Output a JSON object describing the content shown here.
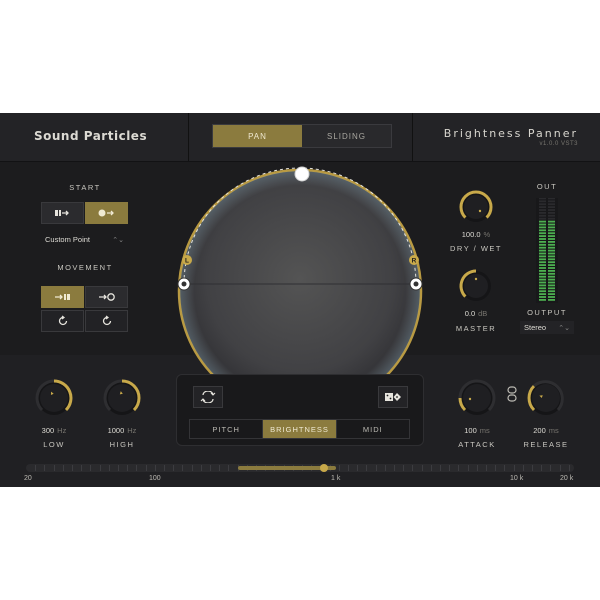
{
  "header": {
    "brand": "Sound Particles",
    "tabs": [
      {
        "label": "PAN",
        "active": true
      },
      {
        "label": "SLIDING",
        "active": false
      }
    ],
    "plugin_title": "Brightness Panner",
    "version": "v1.0.0 VST3"
  },
  "start": {
    "label": "START",
    "dropdown_value": "Custom Point"
  },
  "movement": {
    "label": "MOVEMENT"
  },
  "panner": {
    "left_badge": "L",
    "right_badge": "R"
  },
  "dry_wet": {
    "value": "100.0",
    "unit": "%",
    "label": "DRY / WET",
    "level": 1.0
  },
  "master": {
    "value": "0.0",
    "unit": "dB",
    "label": "MASTER"
  },
  "out": {
    "label": "OUT",
    "output_label": "OUTPUT",
    "output_value": "Stereo"
  },
  "low": {
    "value": "300",
    "unit": "Hz",
    "label": "LOW"
  },
  "high": {
    "value": "1000",
    "unit": "Hz",
    "label": "HIGH"
  },
  "attack": {
    "value": "100",
    "unit": "ms",
    "label": "ATTACK"
  },
  "release": {
    "value": "200",
    "unit": "ms",
    "label": "RELEASE"
  },
  "modes": [
    {
      "label": "PITCH",
      "active": false
    },
    {
      "label": "BRIGHTNESS",
      "active": true
    },
    {
      "label": "MIDI",
      "active": false
    }
  ],
  "frequency_axis": {
    "labels": [
      "20",
      "100",
      "1 k",
      "10 k",
      "20 k"
    ]
  },
  "colors": {
    "accent": "#c8a94a",
    "accent_dark": "#8b7b3e",
    "bg": "#1c1c1e",
    "meter_green": "#4caf50"
  }
}
